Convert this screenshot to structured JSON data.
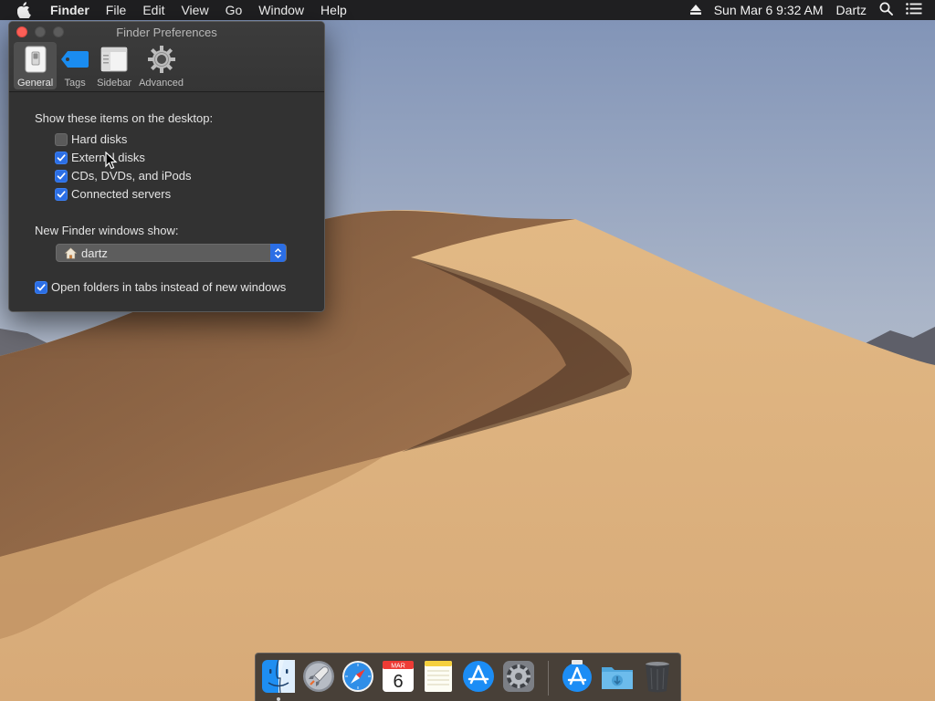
{
  "menubar": {
    "app_name": "Finder",
    "menus": [
      "File",
      "Edit",
      "View",
      "Go",
      "Window",
      "Help"
    ],
    "clock": "Sun Mar 6  9:32 AM",
    "user": "Dartz"
  },
  "window": {
    "title": "Finder Preferences",
    "tabs": [
      {
        "label": "General",
        "icon": "general-switch-icon",
        "selected": true
      },
      {
        "label": "Tags",
        "icon": "tag-icon",
        "selected": false
      },
      {
        "label": "Sidebar",
        "icon": "sidebar-icon",
        "selected": false
      },
      {
        "label": "Advanced",
        "icon": "gear-icon",
        "selected": false
      }
    ],
    "desktop_section_label": "Show these items on the desktop:",
    "desktop_items": [
      {
        "label": "Hard disks",
        "checked": false
      },
      {
        "label": "External disks",
        "checked": true
      },
      {
        "label": "CDs, DVDs, and iPods",
        "checked": true
      },
      {
        "label": "Connected servers",
        "checked": true
      }
    ],
    "new_window_label": "New Finder windows show:",
    "new_window_value": "dartz",
    "open_in_tabs": {
      "label": "Open folders in tabs instead of new windows",
      "checked": true
    }
  },
  "dock": {
    "items": [
      {
        "name": "finder-icon",
        "running": true
      },
      {
        "name": "launchpad-icon",
        "running": false
      },
      {
        "name": "safari-icon",
        "running": false
      },
      {
        "name": "calendar-icon",
        "running": false,
        "month": "MAR",
        "day": "6"
      },
      {
        "name": "notes-icon",
        "running": false
      },
      {
        "name": "app-store-icon",
        "running": false
      },
      {
        "name": "system-preferences-icon",
        "running": false
      },
      {
        "name": "app-store-downloads-icon",
        "running": false
      },
      {
        "name": "downloads-folder-icon",
        "running": false
      },
      {
        "name": "trash-icon",
        "running": false
      }
    ]
  },
  "colors": {
    "accent": "#2b6ee5",
    "close_button": "#fc5f57",
    "window_bg": "#323232",
    "menubar_bg": "#1f1f21"
  }
}
